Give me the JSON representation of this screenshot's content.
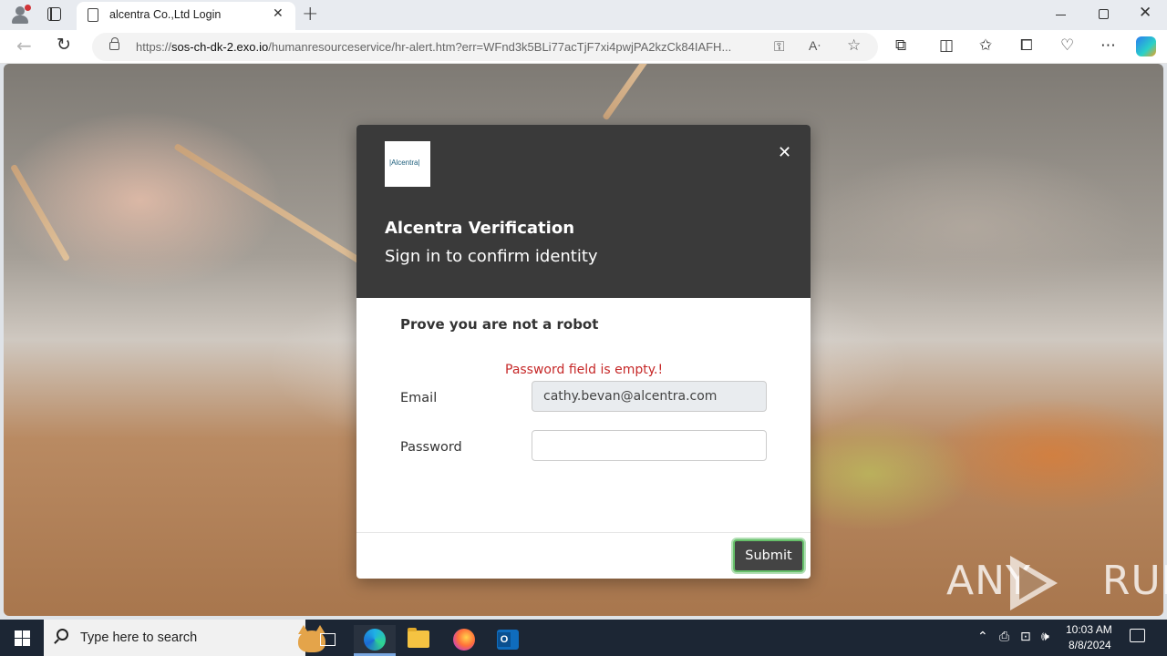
{
  "browser": {
    "tab_title": "alcentra Co.,Ltd Login",
    "url_scheme": "https://",
    "url_host": "sos-ch-dk-2.exo.io",
    "url_path": "/humanresourceservice/hr-alert.htm?err=WFnd3k5BLi77acTjF7xi4pwjPA2kzCk84IAFH..."
  },
  "modal": {
    "logo_text": "|Alcentra|",
    "title": "Alcentra Verification",
    "subtitle": "Sign in to confirm identity",
    "robot_heading": "Prove you are not a robot",
    "error": "Password field is empty.!",
    "email_label": "Email",
    "email_value": "cathy.bevan@alcentra.com",
    "password_label": "Password",
    "password_value": "",
    "submit_label": "Submit"
  },
  "watermark": {
    "left": "ANY",
    "right": "RUN"
  },
  "taskbar": {
    "search_placeholder": "Type here to search",
    "time": "10:03 AM",
    "date": "8/8/2024"
  },
  "colors": {
    "modal_header": "#3a3a3a",
    "error": "#c62828",
    "submit_bg": "#444444",
    "submit_focus": "#66c06a"
  }
}
